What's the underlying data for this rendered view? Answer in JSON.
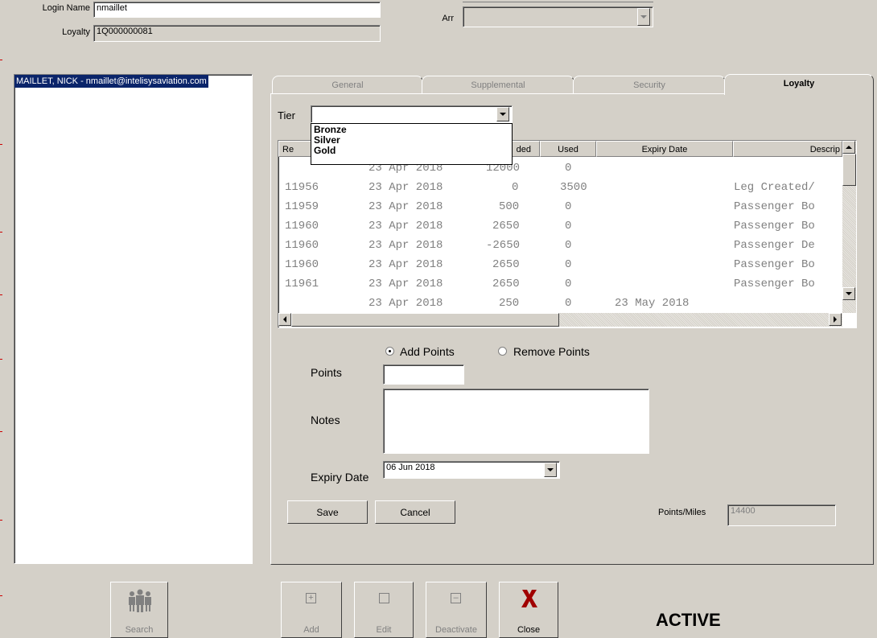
{
  "header": {
    "login_label": "Login Name",
    "login_value": "nmaillet",
    "loyalty_label": "Loyalty",
    "loyalty_value": "1Q000000081",
    "arr_label": "Arr",
    "arr_value": ""
  },
  "users_list": [
    "MAILLET, NICK  - nmaillet@intelisysaviation.com"
  ],
  "tabs": [
    {
      "label": "General",
      "active": false
    },
    {
      "label": "Supplemental",
      "active": false
    },
    {
      "label": "Security",
      "active": false
    },
    {
      "label": "Loyalty",
      "active": true
    }
  ],
  "tier": {
    "label": "Tier",
    "value": "",
    "options": [
      "Bronze",
      "Silver",
      "Gold"
    ]
  },
  "grid": {
    "columns": [
      "Re",
      "ded",
      "Used",
      "Expiry Date",
      "Descrip"
    ],
    "rows": [
      {
        "ref": "",
        "date": "23 Apr 2018",
        "added": "12000",
        "used": "0",
        "expiry": "",
        "desc": ""
      },
      {
        "ref": "11956",
        "date": "23 Apr 2018",
        "added": "0",
        "used": "3500",
        "expiry": "",
        "desc": "Leg Created/"
      },
      {
        "ref": "11959",
        "date": "23 Apr 2018",
        "added": "500",
        "used": "0",
        "expiry": "",
        "desc": "Passenger Bo"
      },
      {
        "ref": "11960",
        "date": "23 Apr 2018",
        "added": "2650",
        "used": "0",
        "expiry": "",
        "desc": "Passenger Bo"
      },
      {
        "ref": "11960",
        "date": "23 Apr 2018",
        "added": "-2650",
        "used": "0",
        "expiry": "",
        "desc": "Passenger De"
      },
      {
        "ref": "11960",
        "date": "23 Apr 2018",
        "added": "2650",
        "used": "0",
        "expiry": "",
        "desc": "Passenger Bo"
      },
      {
        "ref": "11961",
        "date": "23 Apr 2018",
        "added": "2650",
        "used": "0",
        "expiry": "",
        "desc": "Passenger Bo"
      },
      {
        "ref": "",
        "date": "23 Apr 2018",
        "added": "250",
        "used": "0",
        "expiry": "23 May 2018",
        "desc": ""
      }
    ]
  },
  "form": {
    "add_points_label": "Add Points",
    "remove_points_label": "Remove Points",
    "selected_mode": "add",
    "points_label": "Points",
    "points_value": "",
    "notes_label": "Notes",
    "notes_value": "",
    "expiry_label": "Expiry Date",
    "expiry_value": "06 Jun 2018",
    "save_label": "Save",
    "cancel_label": "Cancel",
    "points_miles_label": "Points/Miles",
    "points_miles_value": "14400"
  },
  "toolbar": {
    "search_label": "Search",
    "add_label": "Add",
    "edit_label": "Edit",
    "deactivate_label": "Deactivate",
    "close_label": "Close",
    "status_text": "ACTIVE"
  },
  "colors": {
    "window_bg": "#d4d0c8",
    "selection": "#0a246a",
    "close_icon": "#a00000"
  }
}
